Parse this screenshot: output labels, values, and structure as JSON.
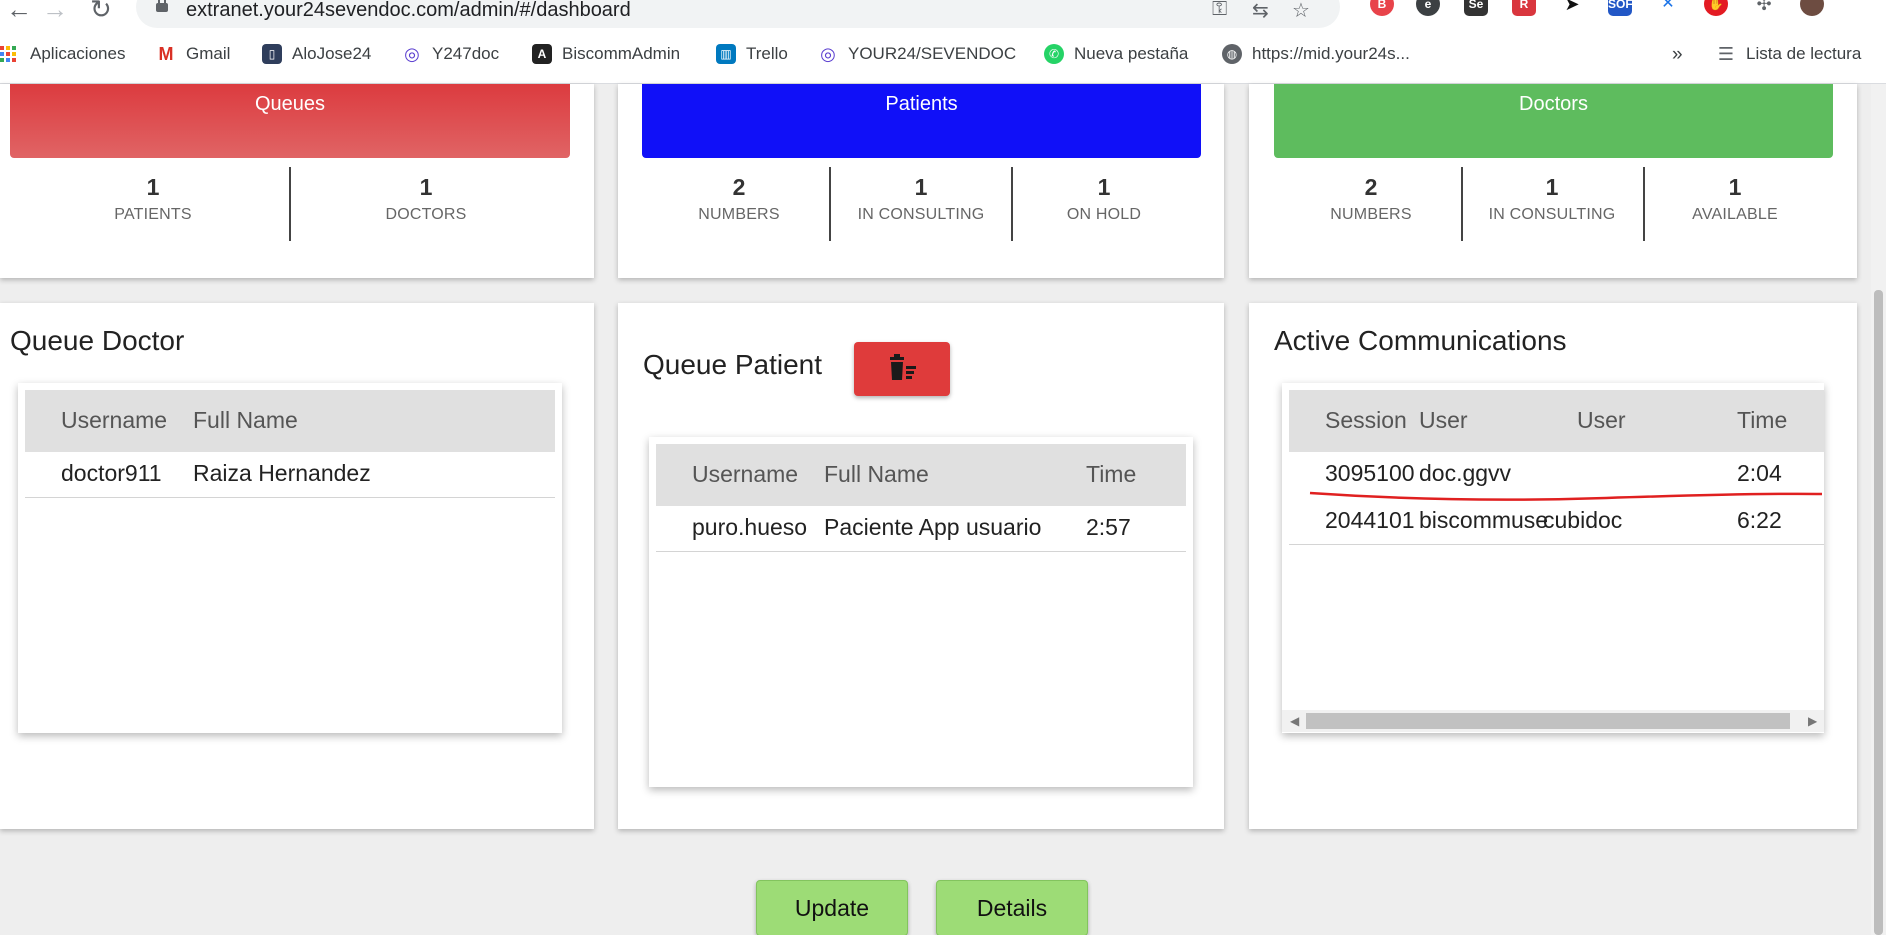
{
  "browser": {
    "url": "extranet.your24sevendoc.com/admin/#/dashboard",
    "bookmarks": [
      {
        "label": "Aplicaciones",
        "icon": "apps-grid-icon"
      },
      {
        "label": "Gmail",
        "icon": "gmail-icon"
      },
      {
        "label": "AloJose24",
        "icon": "bookmark-icon"
      },
      {
        "label": "Y247doc",
        "icon": "your247-icon"
      },
      {
        "label": "BiscommAdmin",
        "icon": "angular-icon"
      },
      {
        "label": "Trello",
        "icon": "trello-icon"
      },
      {
        "label": "YOUR24/SEVENDOC",
        "icon": "your247-icon"
      },
      {
        "label": "Nueva pestaña",
        "icon": "whatsapp-icon"
      },
      {
        "label": "https://mid.your24s...",
        "icon": "globe-icon"
      }
    ],
    "more_bookmarks": "»",
    "reading_list": "Lista de lectura"
  },
  "summary": {
    "queues": {
      "title": "Queues",
      "color": "#dc3b3f",
      "stats": [
        {
          "value": "1",
          "label": "PATIENTS"
        },
        {
          "value": "1",
          "label": "DOCTORS"
        }
      ]
    },
    "patients": {
      "title": "Patients",
      "color": "#1010f8",
      "stats": [
        {
          "value": "2",
          "label": "NUMBERS"
        },
        {
          "value": "1",
          "label": "IN CONSULTING"
        },
        {
          "value": "1",
          "label": "ON HOLD"
        }
      ]
    },
    "doctors": {
      "title": "Doctors",
      "color": "#5ebc5e",
      "stats": [
        {
          "value": "2",
          "label": "NUMBERS"
        },
        {
          "value": "1",
          "label": "IN CONSULTING"
        },
        {
          "value": "1",
          "label": "AVAILABLE"
        }
      ]
    }
  },
  "queue_doctor": {
    "title": "Queue Doctor",
    "columns": [
      "Username",
      "Full Name"
    ],
    "rows": [
      [
        "doctor911",
        "Raiza Hernandez"
      ]
    ]
  },
  "queue_patient": {
    "title": "Queue Patient",
    "columns": [
      "Username",
      "Full Name",
      "Time"
    ],
    "rows": [
      [
        "puro.hueso",
        "Paciente App usuario",
        "2:57"
      ]
    ]
  },
  "active_communications": {
    "title": "Active Communications",
    "columns": [
      "Session",
      "User",
      "User",
      "Time"
    ],
    "rows": [
      [
        "3095100",
        "doc.ggvv",
        "",
        "2:04"
      ],
      [
        "2044101",
        "biscommusern",
        "cubidoc",
        "6:22"
      ]
    ]
  },
  "actions": {
    "update": "Update",
    "details": "Details"
  }
}
